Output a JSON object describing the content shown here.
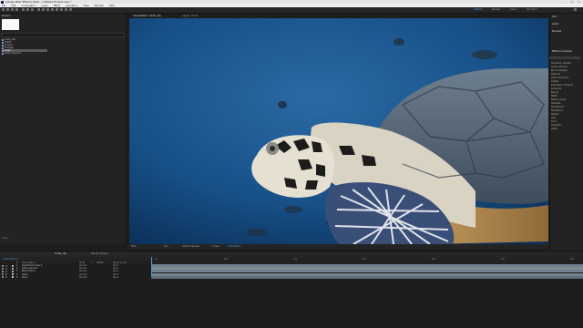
{
  "app": {
    "title": "Adobe After Effects 2021 - Untitled Project.aep *"
  },
  "menu": [
    "File",
    "Edit",
    "Composition",
    "Layer",
    "Effect",
    "Animation",
    "View",
    "Window",
    "Help"
  ],
  "workspaces": [
    "Default",
    "Review",
    "Learn",
    "Standard"
  ],
  "project": {
    "tab": "Project",
    "search_placeholder": "",
    "items": [
      "turtle_clip",
      "Solids",
      "Comp 1",
      "Footage",
      "Audio",
      "turtle_clip.mov"
    ],
    "selected_index": 4,
    "footer": "8 bpc"
  },
  "composition": {
    "tabs": [
      "Composition: turtle_clip",
      "Layer: (none)"
    ],
    "viewer_controls": [
      "50%",
      "Full",
      "Active Camera",
      "1 View",
      "0;00;05;12"
    ]
  },
  "right_panel": {
    "sections": [
      "Info",
      "Audio",
      "Preview",
      "Effects & Presets"
    ],
    "items": [
      "Animation Presets",
      "Audio Channel",
      "Blur & Sharpen",
      "Channel",
      "Color Correction",
      "Distort",
      "Expression Controls",
      "Generate",
      "Keying",
      "Matte",
      "Noise & Grain",
      "Obsolete",
      "Perspective",
      "Simulation",
      "Stylize",
      "Text",
      "Time",
      "Transition",
      "Utility"
    ]
  },
  "timeline": {
    "tabs": [
      "turtle_clip",
      "Render Queue"
    ],
    "current_time": "0;00;05;12",
    "columns": [
      "#",
      "Source Name",
      "Mode",
      "T",
      "TrkMat",
      "Parent & Link"
    ],
    "layers": [
      {
        "num": "1",
        "name": "Adjustment Layer 1",
        "mode": "Normal",
        "parent": "None",
        "color": "#a7a9d0"
      },
      {
        "num": "2",
        "name": "turtle_clip.mov",
        "mode": "Normal",
        "parent": "None",
        "color": "#8fb7c8"
      },
      {
        "num": "3",
        "name": "Black Solid 1",
        "mode": "Normal",
        "parent": "None",
        "color": "#c8a2a2"
      },
      {
        "num": "4",
        "name": "Audio",
        "mode": "Normal",
        "parent": "None",
        "color": "#a3c8a2"
      },
      {
        "num": "5",
        "name": "Null 1",
        "mode": "Normal",
        "parent": "None",
        "color": "#c8c3a2"
      }
    ],
    "ruler": [
      "0s",
      "05s",
      "10s",
      "15s",
      "20s",
      "25s",
      "30s"
    ],
    "bar_colors": [
      "#6f7f8f",
      "#7b8e8e",
      "#6f7f8f",
      "#72868e",
      "#5f6f7a"
    ]
  }
}
